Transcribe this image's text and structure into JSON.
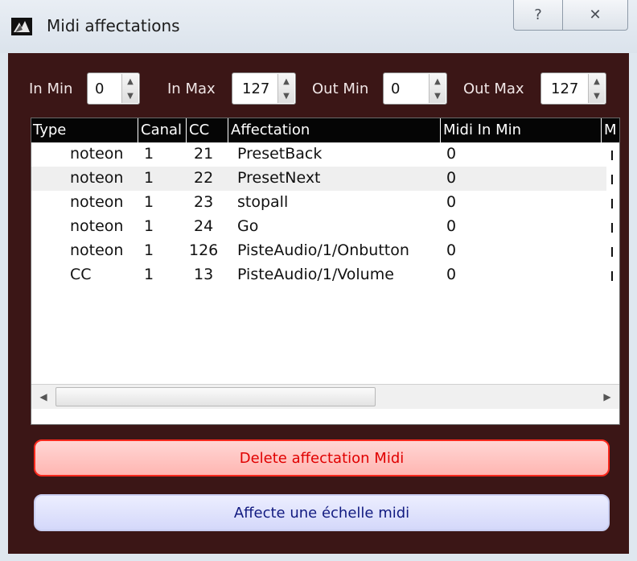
{
  "window": {
    "title": "Midi affectations",
    "help_glyph": "?",
    "close_glyph": "✕"
  },
  "spinboxes": [
    {
      "label": "In Min",
      "value": "0"
    },
    {
      "label": "In Max",
      "value": "127"
    },
    {
      "label": "Out Min",
      "value": "0"
    },
    {
      "label": "Out Max",
      "value": "127"
    }
  ],
  "table": {
    "columns": [
      "Type",
      "Canal",
      "CC",
      "Affectation",
      "Midi In Min",
      "M"
    ],
    "rows": [
      {
        "type": "noteon",
        "canal": "1",
        "cc": "21",
        "affectation": "PresetBack",
        "midi_in_min": "0"
      },
      {
        "type": "noteon",
        "canal": "1",
        "cc": "22",
        "affectation": "PresetNext",
        "midi_in_min": "0"
      },
      {
        "type": "noteon",
        "canal": "1",
        "cc": "23",
        "affectation": "stopall",
        "midi_in_min": "0"
      },
      {
        "type": "noteon",
        "canal": "1",
        "cc": "24",
        "affectation": "Go",
        "midi_in_min": "0"
      },
      {
        "type": "noteon",
        "canal": "1",
        "cc": "126",
        "affectation": "PisteAudio/1/Onbutton",
        "midi_in_min": "0"
      },
      {
        "type": "CC",
        "canal": "1",
        "cc": "13",
        "affectation": "PisteAudio/1/Volume",
        "midi_in_min": "0"
      }
    ],
    "scroll_left_glyph": "◀",
    "scroll_right_glyph": "▶"
  },
  "buttons": {
    "delete_label": "Delete affectation Midi",
    "scale_label": "Affecte une échelle midi"
  },
  "colors": {
    "client_background": "#3b1616",
    "delete_text": "#e00000",
    "delete_border": "#ff2a1e",
    "scale_text": "#111a80"
  },
  "icons": {
    "app": "app-logo-icon",
    "help": "help-icon",
    "close": "close-icon"
  }
}
